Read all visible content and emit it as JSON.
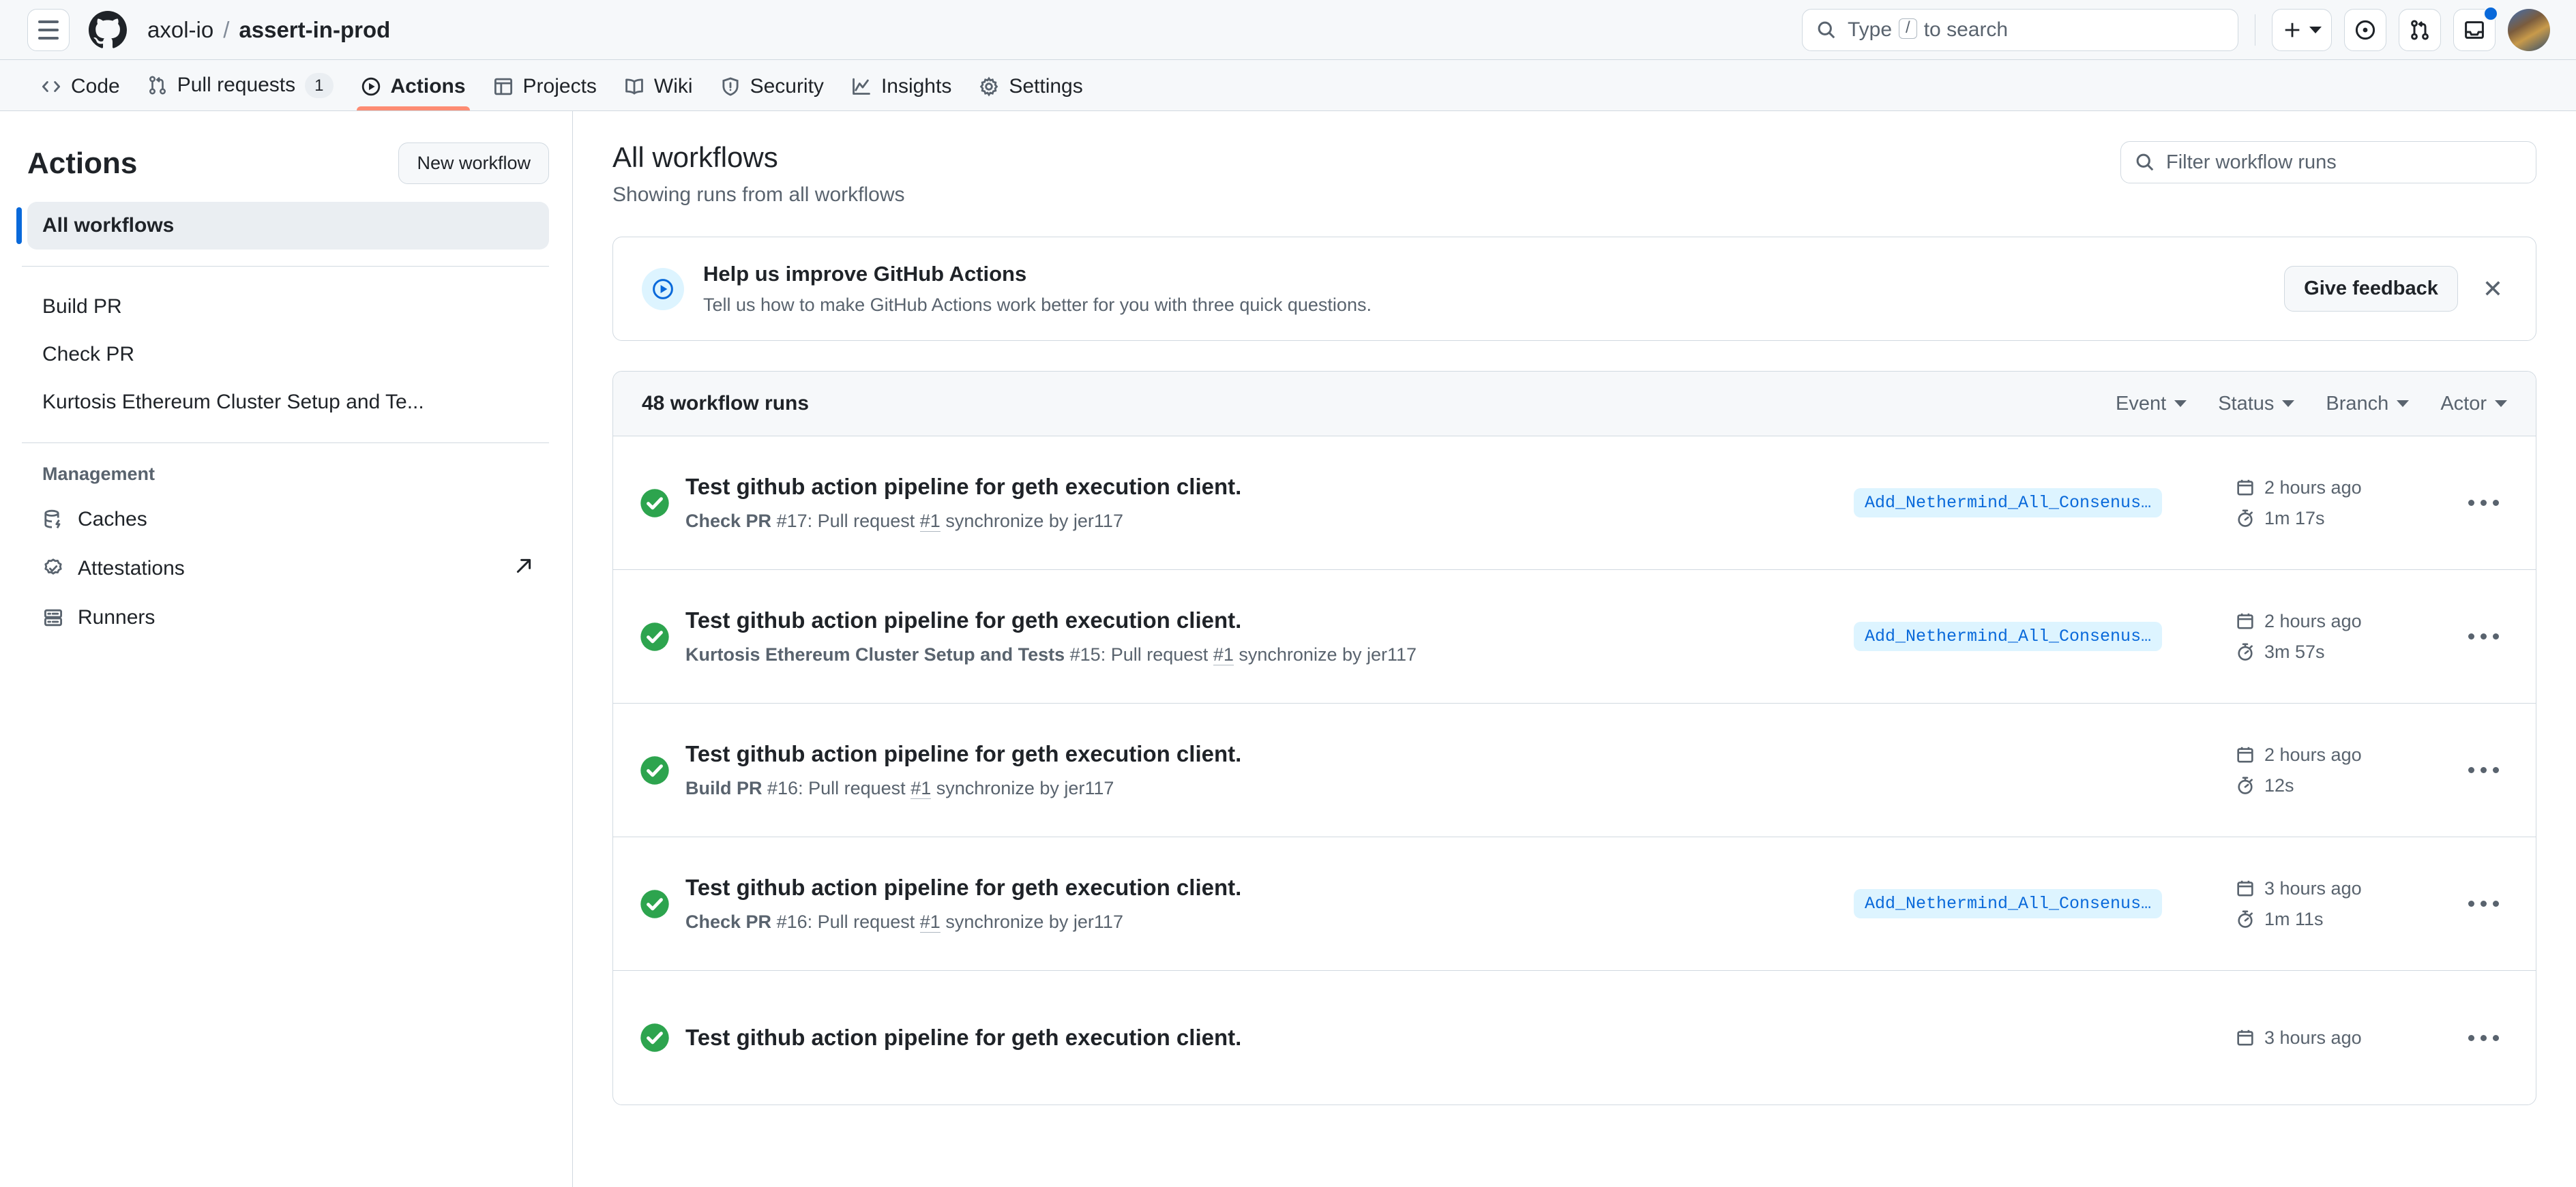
{
  "header": {
    "hamburger_icon": "hamburger-menu-icon",
    "logo_icon": "github-logo-icon",
    "owner": "axol-io",
    "separator": "/",
    "repo": "assert-in-prod",
    "search": {
      "placeholder_prefix": "Type",
      "slash_key": "/",
      "placeholder_suffix": "to search",
      "icon": "search-icon"
    },
    "create_button": {
      "icon": "plus-icon",
      "caret": "chevron-down-icon"
    },
    "issues_button": {
      "icon": "issue-opened-icon"
    },
    "pull_requests_button": {
      "icon": "git-pull-request-icon"
    },
    "inbox_button": {
      "icon": "inbox-icon",
      "has_notification": true
    },
    "avatar": {
      "icon": "avatar"
    }
  },
  "repo_nav": {
    "tabs": [
      {
        "label": "Code",
        "icon": "code-icon",
        "active": false
      },
      {
        "label": "Pull requests",
        "icon": "git-pull-request-icon",
        "active": false,
        "count": "1"
      },
      {
        "label": "Actions",
        "icon": "play-circle-icon",
        "active": true
      },
      {
        "label": "Projects",
        "icon": "table-icon",
        "active": false
      },
      {
        "label": "Wiki",
        "icon": "book-icon",
        "active": false
      },
      {
        "label": "Security",
        "icon": "shield-icon",
        "active": false
      },
      {
        "label": "Insights",
        "icon": "graph-icon",
        "active": false
      },
      {
        "label": "Settings",
        "icon": "gear-icon",
        "active": false
      }
    ]
  },
  "sidebar": {
    "title": "Actions",
    "new_workflow_label": "New workflow",
    "all_workflows": "All workflows",
    "workflows": [
      {
        "label": "Build PR"
      },
      {
        "label": "Check PR"
      },
      {
        "label": "Kurtosis Ethereum Cluster Setup and Te..."
      }
    ],
    "management_title": "Management",
    "management_items": [
      {
        "label": "Caches",
        "icon": "cache-icon",
        "external": false
      },
      {
        "label": "Attestations",
        "icon": "verified-badge-icon",
        "external": true
      },
      {
        "label": "Runners",
        "icon": "server-icon",
        "external": false
      }
    ]
  },
  "main": {
    "title": "All workflows",
    "subtitle": "Showing runs from all workflows",
    "filter": {
      "placeholder": "Filter workflow runs",
      "icon": "search-icon"
    },
    "banner": {
      "icon": "play-circle-icon",
      "title": "Help us improve GitHub Actions",
      "subtitle": "Tell us how to make GitHub Actions work better for you with three quick questions.",
      "button_label": "Give feedback",
      "close_icon": "close-icon"
    },
    "runs_header": {
      "count_label": "48 workflow runs",
      "filters": [
        {
          "label": "Event"
        },
        {
          "label": "Status"
        },
        {
          "label": "Branch"
        },
        {
          "label": "Actor"
        }
      ]
    },
    "runs": [
      {
        "status": "success",
        "status_icon": "check-circle-icon",
        "title": "Test github action pipeline for geth execution client.",
        "workflow_name": "Check PR",
        "run_number": "#17:",
        "event_text": "Pull request",
        "pr_link": "#1",
        "event_suffix": "synchronize by jer117",
        "branch": "Add_Nethermind_All_Consenus…",
        "time_ago": "2 hours ago",
        "duration": "1m 17s"
      },
      {
        "status": "success",
        "status_icon": "check-circle-icon",
        "title": "Test github action pipeline for geth execution client.",
        "workflow_name": "Kurtosis Ethereum Cluster Setup and Tests",
        "run_number": "#15:",
        "event_text": "Pull request",
        "pr_link": "#1",
        "event_suffix": "synchronize by jer117",
        "branch": "Add_Nethermind_All_Consenus…",
        "time_ago": "2 hours ago",
        "duration": "3m 57s"
      },
      {
        "status": "success",
        "status_icon": "check-circle-icon",
        "title": "Test github action pipeline for geth execution client.",
        "workflow_name": "Build PR",
        "run_number": "#16:",
        "event_text": "Pull request",
        "pr_link": "#1",
        "event_suffix": "synchronize by jer117",
        "branch": "",
        "time_ago": "2 hours ago",
        "duration": "12s"
      },
      {
        "status": "success",
        "status_icon": "check-circle-icon",
        "title": "Test github action pipeline for geth execution client.",
        "workflow_name": "Check PR",
        "run_number": "#16:",
        "event_text": "Pull request",
        "pr_link": "#1",
        "event_suffix": "synchronize by jer117",
        "branch": "Add_Nethermind_All_Consenus…",
        "time_ago": "3 hours ago",
        "duration": "1m 11s"
      },
      {
        "status": "success",
        "status_icon": "check-circle-icon",
        "title": "Test github action pipeline for geth execution client.",
        "workflow_name": "",
        "run_number": "",
        "event_text": "",
        "pr_link": "",
        "event_suffix": "",
        "branch": "",
        "time_ago": "3 hours ago",
        "duration": ""
      }
    ]
  },
  "colors": {
    "accent": "#0969da",
    "success": "#2da44e",
    "active_tab_underline": "#fd8c73",
    "border": "#d1d9e0",
    "canvas_subtle": "#f6f8fa",
    "muted_text": "#59636e"
  }
}
